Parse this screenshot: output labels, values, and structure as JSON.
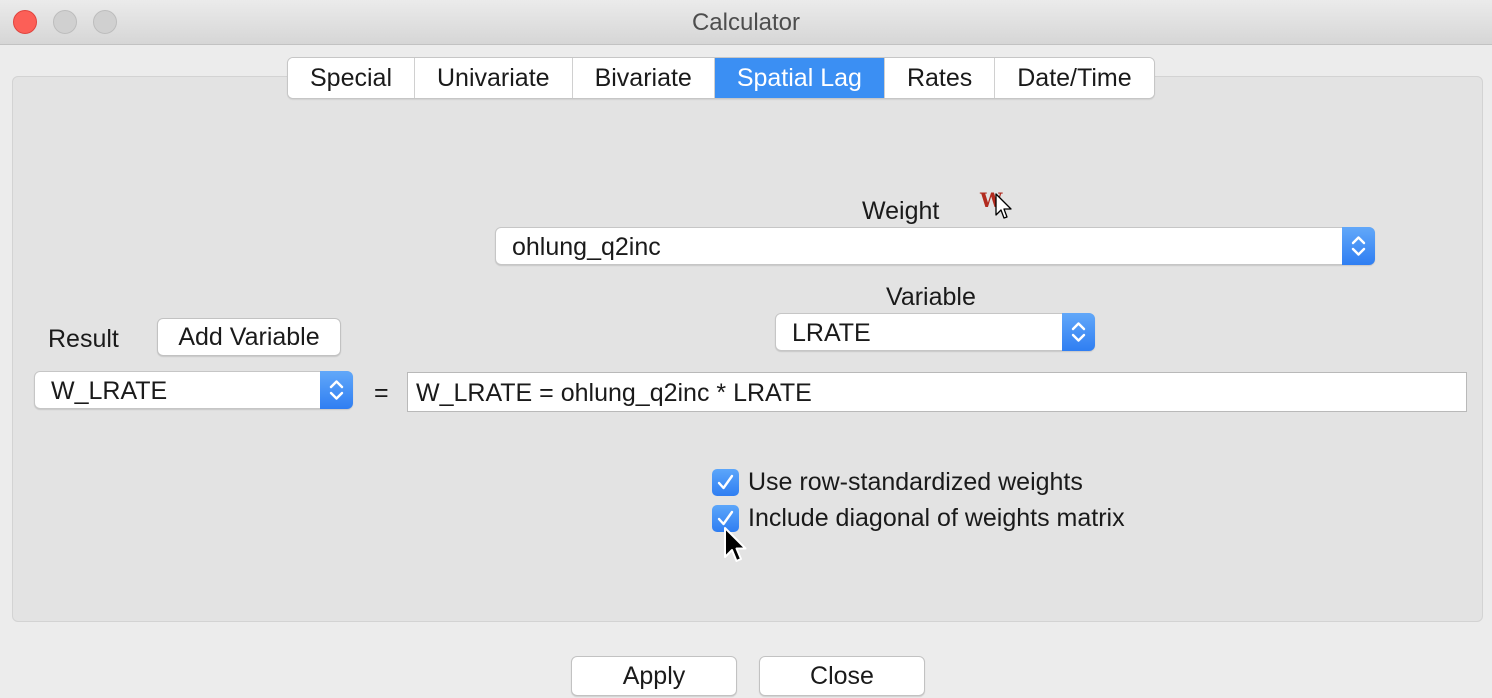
{
  "window": {
    "title": "Calculator"
  },
  "tabs": [
    {
      "label": "Special",
      "active": false
    },
    {
      "label": "Univariate",
      "active": false
    },
    {
      "label": "Bivariate",
      "active": false
    },
    {
      "label": "Spatial Lag",
      "active": true
    },
    {
      "label": "Rates",
      "active": false
    },
    {
      "label": "Date/Time",
      "active": false
    }
  ],
  "weight": {
    "label": "Weight",
    "selected": "ohlung_q2inc",
    "icon_glyph": "W"
  },
  "variable": {
    "label": "Variable",
    "selected": "LRATE"
  },
  "result": {
    "label": "Result",
    "add_variable_label": "Add Variable",
    "selected": "W_LRATE",
    "equals": "="
  },
  "formula": {
    "value": "W_LRATE = ohlung_q2inc * LRATE"
  },
  "options": {
    "row_standardized": {
      "label": "Use row-standardized weights",
      "checked": true
    },
    "include_diagonal": {
      "label": "Include diagonal of weights matrix",
      "checked": true
    }
  },
  "footer": {
    "apply_label": "Apply",
    "close_label": "Close"
  },
  "colors": {
    "accent": "#3b8ff3",
    "close_traffic": "#fc5f57",
    "weights_icon": "#b22b1f"
  }
}
